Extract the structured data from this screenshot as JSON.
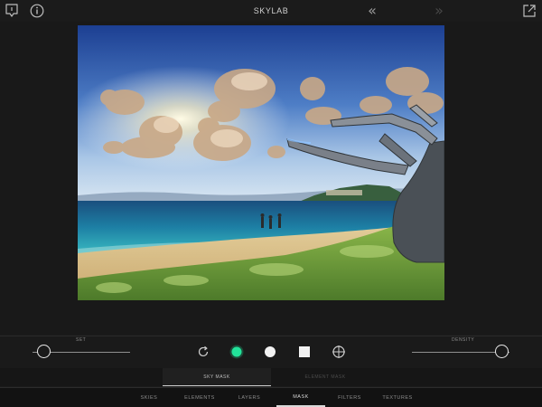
{
  "app": {
    "title": "SKYLAB"
  },
  "toolbar": {
    "export_icon": "tray-down-icon",
    "info_icon": "info-icon",
    "undo_icon": "double-chevron-left-icon",
    "redo_icon": "double-chevron-right-icon",
    "share_icon": "share-arrow-icon"
  },
  "controls": {
    "left_slider": {
      "label": "SET",
      "value": 0.1
    },
    "right_slider": {
      "label": "DENSITY",
      "value": 0.9
    },
    "tools": [
      {
        "name": "rotate-refresh-icon"
      },
      {
        "name": "green-brush-dot-icon",
        "color": "#22e39a"
      },
      {
        "name": "white-circle-brush-icon"
      },
      {
        "name": "white-square-brush-icon"
      },
      {
        "name": "crosshair-target-icon"
      }
    ]
  },
  "subtabs": [
    {
      "label": "SKY MASK",
      "active": true
    },
    {
      "label": "ELEMENT MASK",
      "active": false
    }
  ],
  "bottom_nav": [
    {
      "label": "SKIES",
      "active": false
    },
    {
      "label": "ELEMENTS",
      "active": false
    },
    {
      "label": "LAYERS",
      "active": false
    },
    {
      "label": "MASK",
      "active": true
    },
    {
      "label": "FILTERS",
      "active": false
    },
    {
      "label": "TEXTURES",
      "active": false
    }
  ],
  "colors": {
    "background": "#1b1b1b",
    "accent": "#22e39a",
    "text": "#d7d7d7"
  }
}
